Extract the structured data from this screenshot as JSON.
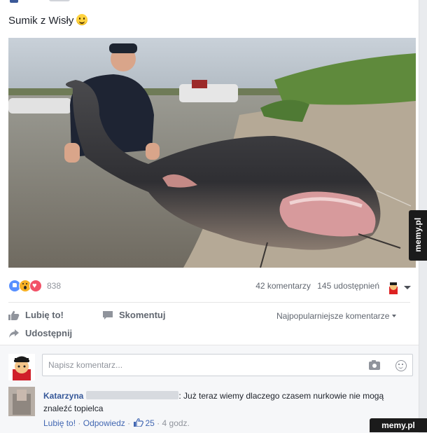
{
  "post": {
    "caption": "Sumik z Wisły",
    "reactions": {
      "count": "838",
      "types": [
        "like-icon",
        "wow-icon",
        "love-icon"
      ]
    },
    "comments_count": "42 komentarzy",
    "shares_count": "145 udostępnień"
  },
  "actions": {
    "like": "Lubię to!",
    "comment": "Skomentuj",
    "share": "Udostępnij",
    "sort": "Najpopularniejsze komentarze"
  },
  "composer": {
    "placeholder": "Napisz komentarz..."
  },
  "comment": {
    "author": "Katarzyna",
    "text": ": Już teraz wiemy dlaczego czasem nurkowie nie mogą znaleźć topielca",
    "like": "Lubię to!",
    "reply": "Odpowiedz",
    "likes_count": "25",
    "time": "4 godz."
  },
  "watermark": {
    "side": "memy.pl",
    "corner": "memy.pl"
  },
  "colors": {
    "link": "#365899",
    "accent": "#4267b2",
    "muted": "#90949c",
    "background": "#e9ebee"
  }
}
